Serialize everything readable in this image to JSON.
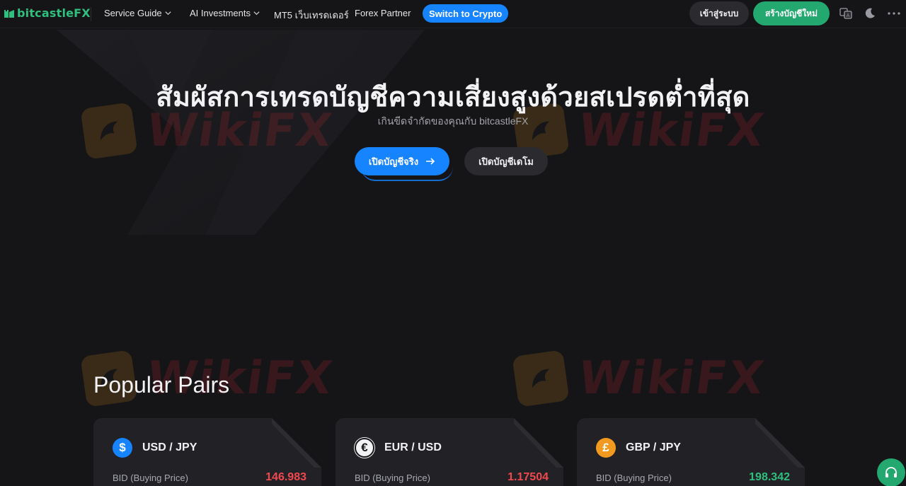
{
  "nav": {
    "brand": "bitcastleFX",
    "items": [
      {
        "label": "Service Guide",
        "dropdown": true
      },
      {
        "label": "AI Investments",
        "dropdown": true
      },
      {
        "label": "MT5 เว็บเทรดเดอร์",
        "dropdown": false
      },
      {
        "label": "Forex Partner",
        "dropdown": false
      }
    ],
    "crypto_button": "Switch to Crypto",
    "login_button": "เข้าสู่ระบบ",
    "register_button": "สร้างบัญชีใหม่",
    "icons": [
      "translate-icon",
      "moon-icon",
      "more-icon"
    ]
  },
  "hero": {
    "title": "สัมผัสการเทรดบัญชีความเสี่ยงสูงด้วยสเปรดต่ำที่สุด",
    "subtitle": "เกินขีดจำกัดของคุณกับ bitcastleFX",
    "real_button": "เปิดบัญชีจริง",
    "demo_button": "เปิดบัญชีเดโม"
  },
  "watermark": "WikiFX",
  "popular": {
    "title": "Popular Pairs",
    "pairs": [
      {
        "name": "USD / JPY",
        "symbol": "$",
        "icon_color": "#1683ff",
        "bid_label": "BID (Buying Price)",
        "bid": "146.983",
        "bid_color": "#f0484f"
      },
      {
        "name": "EUR / USD",
        "symbol": "€",
        "icon_color": "#f2f2f4",
        "bid_label": "BID (Buying Price)",
        "bid": "1.17504",
        "bid_color": "#f0484f"
      },
      {
        "name": "GBP / JPY",
        "symbol": "£",
        "icon_color": "#f29a1f",
        "bid_label": "BID (Buying Price)",
        "bid": "198.342",
        "bid_color": "#2fbf7e"
      }
    ]
  },
  "colors": {
    "accent": "#1683ff",
    "brand": "#2fbf7e",
    "down": "#f0484f",
    "up": "#2fbf7e"
  }
}
